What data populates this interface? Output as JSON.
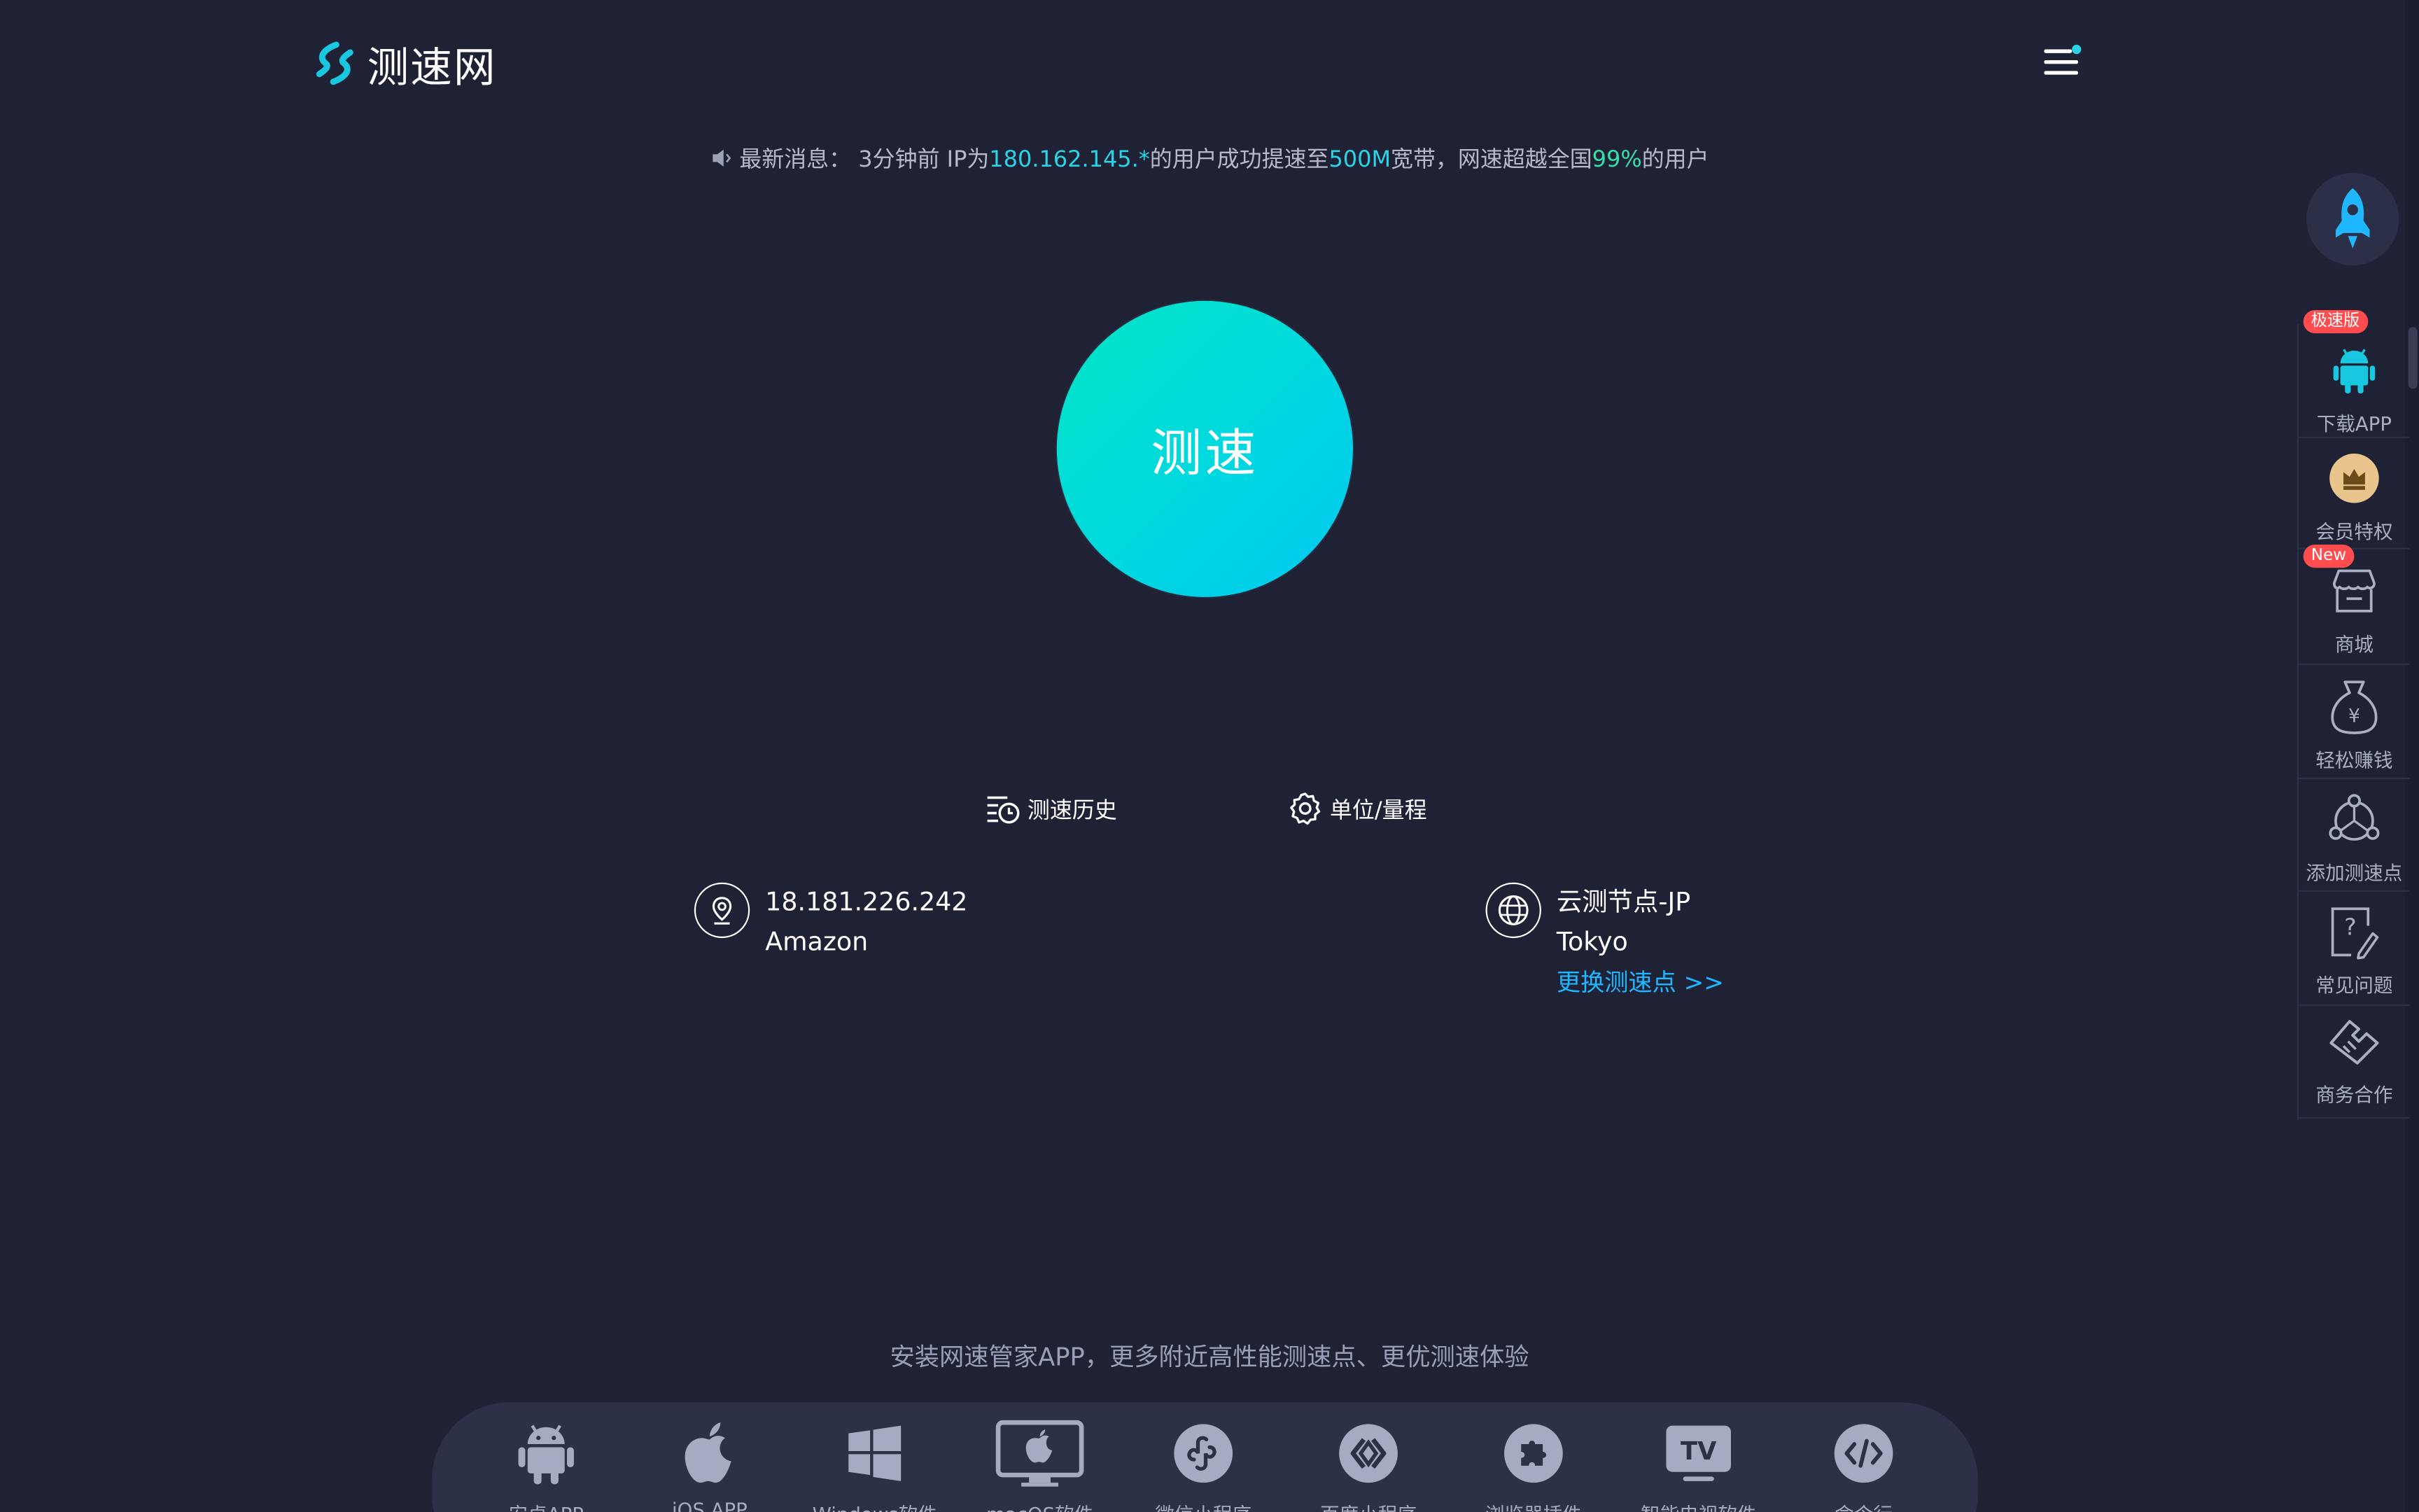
{
  "header": {
    "logo_text": "测速网",
    "menu_icon": "hamburger-icon"
  },
  "news": {
    "prefix": "最新消息：",
    "time_ago": "3分钟前 IP为",
    "ip": "180.162.145.*",
    "mid": "的用户成功提速至",
    "bandwidth": "500M",
    "mid2": "宽带，网速超越全国",
    "percent": "99%",
    "suffix": "的用户"
  },
  "speedtest": {
    "start_label": "测速"
  },
  "tools": {
    "history_label": "测速历史",
    "unit_label": "单位/量程"
  },
  "client": {
    "ip": "18.181.226.242",
    "isp": "Amazon"
  },
  "server": {
    "name": "云测节点-JP",
    "city": "Tokyo",
    "change_label": "更换测速点 >>"
  },
  "promo": {
    "text": "安装网速管家APP，更多附近高性能测速点、更优测速体验"
  },
  "platforms": [
    {
      "label": "安卓APP",
      "icon": "android-icon"
    },
    {
      "label": "iOS APP",
      "icon": "apple-icon"
    },
    {
      "label": "Windows软件",
      "icon": "windows-icon"
    },
    {
      "label": "macOS软件",
      "icon": "imac-icon"
    },
    {
      "label": "微信小程序",
      "icon": "wechat-miniprogram-icon"
    },
    {
      "label": "百度小程序",
      "icon": "baidu-miniprogram-icon"
    },
    {
      "label": "浏览器插件",
      "icon": "puzzle-icon"
    },
    {
      "label": "智能电视软件",
      "icon": "tv-icon"
    },
    {
      "label": "命令行",
      "icon": "code-icon"
    }
  ],
  "sidebar": {
    "top_icon": "rocket-icon",
    "items": [
      {
        "label": "下载APP",
        "badge": "极速版",
        "icon": "android-icon"
      },
      {
        "label": "会员特权",
        "icon": "crown-icon"
      },
      {
        "label": "商城",
        "badge": "New",
        "icon": "store-icon"
      },
      {
        "label": "轻松赚钱",
        "icon": "money-bag-icon"
      },
      {
        "label": "添加测速点",
        "icon": "network-node-icon"
      },
      {
        "label": "常见问题",
        "icon": "question-icon"
      },
      {
        "label": "商务合作",
        "icon": "handshake-icon"
      }
    ]
  },
  "colors": {
    "background": "#1f2235",
    "accent_cyan": "#2ad4e6",
    "accent_green": "#33e0a8",
    "link_blue": "#1fb7ff",
    "badge_red": "#ff4d4f",
    "button_gradient_start": "#03e5c6",
    "button_gradient_end": "#00c8f0"
  }
}
